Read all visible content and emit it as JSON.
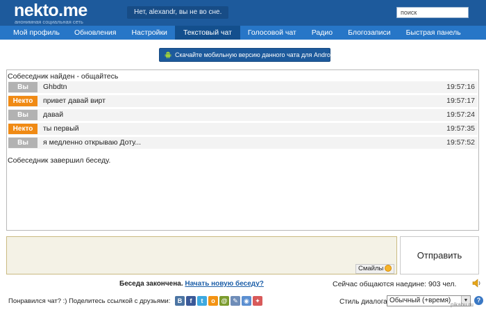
{
  "header": {
    "logo": "nekto.me",
    "logo_subtitle": "анонимная социальная сеть",
    "status": "Нет, alexandr, вы не во сне.",
    "search_placeholder": "поиск"
  },
  "nav": {
    "items": [
      {
        "label": "Мой профиль"
      },
      {
        "label": "Обновления"
      },
      {
        "label": "Настройки"
      },
      {
        "label": "Текстовый чат",
        "active": true
      },
      {
        "label": "Голосовой чат"
      },
      {
        "label": "Радио"
      },
      {
        "label": "Блогозаписи"
      },
      {
        "label": "Быстрая панель"
      }
    ]
  },
  "android_banner": {
    "label": "Скачайте мобильную версию данного чата для Android",
    "icon": "android-icon"
  },
  "chat": {
    "found_text": "Собеседник найден - общайтесь",
    "messages": [
      {
        "author": "Вы",
        "role": "you",
        "text": "Ghbdtn",
        "time": "19:57:16"
      },
      {
        "author": "Некто",
        "role": "nekto",
        "text": "привет давай вирт",
        "time": "19:57:17"
      },
      {
        "author": "Вы",
        "role": "you",
        "text": "давай",
        "time": "19:57:24"
      },
      {
        "author": "Некто",
        "role": "nekto",
        "text": "ты первый",
        "time": "19:57:35"
      },
      {
        "author": "Вы",
        "role": "you",
        "text": "я медленно открываю Доту...",
        "time": "19:57:52"
      }
    ],
    "ended_text": "Собеседник завершил беседу."
  },
  "composer": {
    "input_value": "",
    "smiles_label": "Смайлы",
    "send_label": "Отправить"
  },
  "footer": {
    "conversation_ended": "Беседа закончена.",
    "new_conversation_link": "Начать новую беседу?",
    "online_text": "Сейчас общаются наедине: 903 чел.",
    "share_label": "Понравился чат? :) Поделитесь ссылкой с друзьями:",
    "share_icons": [
      "vk",
      "facebook",
      "twitter",
      "odnoklassniki",
      "mailru",
      "livejournal",
      "moikrug",
      "other"
    ],
    "style_label": "Стиль диалога:",
    "style_value": "Обычный (+время)",
    "watermark": "pikabu.ru"
  },
  "colors": {
    "header_bg": "#1d5a9c",
    "nav_bg": "#2776c7",
    "nav_active": "#134f8d",
    "badge_you": "#b2b2b2",
    "badge_nekto": "#f08a14",
    "link": "#1d5fa8"
  }
}
